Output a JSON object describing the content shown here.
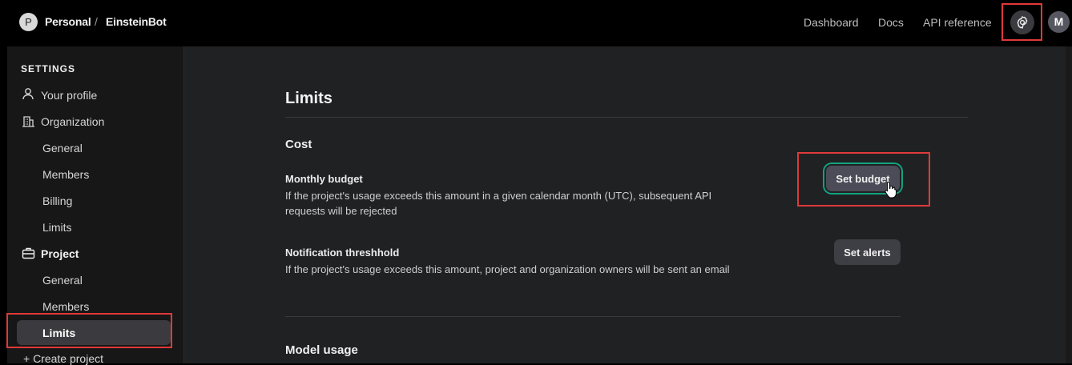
{
  "header": {
    "avatar_initial": "P",
    "workspace": "Personal",
    "separator": "/",
    "project": "EinsteinBot",
    "links": [
      "Dashboard",
      "Docs",
      "API reference"
    ],
    "user_initial": "M"
  },
  "sidebar": {
    "heading": "SETTINGS",
    "your_profile": "Your profile",
    "organization": "Organization",
    "org_items": [
      "General",
      "Members",
      "Billing",
      "Limits"
    ],
    "project": "Project",
    "project_items": [
      "General",
      "Members",
      "Limits"
    ],
    "create_project": "+ Create project"
  },
  "main": {
    "title": "Limits",
    "cost_heading": "Cost",
    "monthly_budget": {
      "title": "Monthly budget",
      "description": "If the project's usage exceeds this amount in a given calendar month (UTC), subsequent API requests will be rejected",
      "button": "Set budget"
    },
    "notification": {
      "title": "Notification threshhold",
      "description": "If the project's usage exceeds this amount, project and organization owners will be sent an email",
      "button": "Set alerts"
    },
    "model_usage_heading": "Model usage"
  },
  "colors": {
    "accent_focus": "#10a37f",
    "highlight_box": "#e0393a"
  }
}
